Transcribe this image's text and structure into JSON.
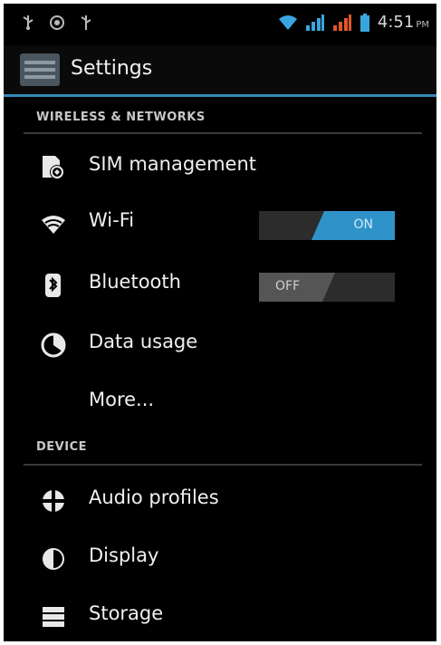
{
  "status_bar": {
    "time": "4:51",
    "ampm": "PM"
  },
  "action_bar": {
    "title": "Settings"
  },
  "sections": {
    "wireless": {
      "header": "WIRELESS & NETWORKS",
      "items": {
        "sim": {
          "label": "SIM management",
          "icon": "sim-icon"
        },
        "wifi": {
          "label": "Wi-Fi",
          "icon": "wifi-icon",
          "toggle": "ON"
        },
        "bluetooth": {
          "label": "Bluetooth",
          "icon": "bluetooth-icon",
          "toggle": "OFF"
        },
        "data": {
          "label": "Data usage",
          "icon": "data-usage-icon"
        },
        "more": {
          "label": "More..."
        }
      }
    },
    "device": {
      "header": "DEVICE",
      "items": {
        "audio": {
          "label": "Audio profiles",
          "icon": "audio-profiles-icon"
        },
        "display": {
          "label": "Display",
          "icon": "display-icon"
        },
        "storage": {
          "label": "Storage",
          "icon": "storage-icon"
        }
      }
    }
  },
  "colors": {
    "accent": "#2f93c9",
    "background": "#000000"
  }
}
